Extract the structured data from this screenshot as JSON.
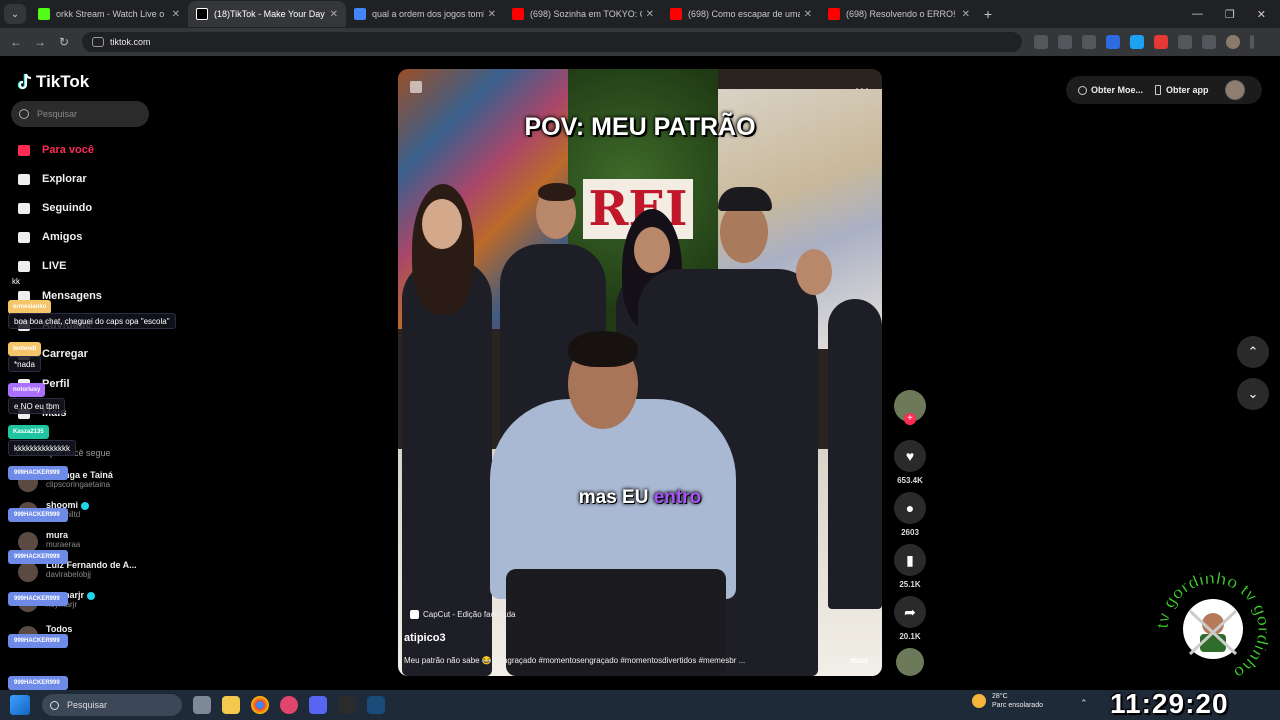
{
  "browser": {
    "tabs": [
      {
        "title": "orkk Stream - Watch Live o",
        "color": "#53fc18"
      },
      {
        "title": "(18)TikTok - Make Your Day",
        "color": "#000000",
        "active": true
      },
      {
        "title": "qual a ordem dos jogos tomb",
        "color": "#4285f4"
      },
      {
        "title": "(698) Sozinha em TOKYO: QUA",
        "color": "#ff0000"
      },
      {
        "title": "(698) Como escapar de uma pr",
        "color": "#ff0000"
      },
      {
        "title": "(698) Resolvendo o ERRO! Uni",
        "color": "#ff0000"
      }
    ],
    "url": "tiktok.com"
  },
  "sidebar": {
    "logo": "TikTok",
    "search_placeholder": "Pesquisar",
    "menu": [
      {
        "label": "Para você",
        "icon": "home-icon",
        "active": true
      },
      {
        "label": "Explorar",
        "icon": "compass-icon"
      },
      {
        "label": "Seguindo",
        "icon": "following-icon"
      },
      {
        "label": "Amigos",
        "icon": "friends-icon"
      },
      {
        "label": "LIVE",
        "icon": "live-icon"
      },
      {
        "label": "Mensagens",
        "icon": "messages-icon"
      },
      {
        "label": "Atividade",
        "icon": "activity-icon"
      },
      {
        "label": "Carregar",
        "icon": "upload-icon"
      },
      {
        "label": "Perfil",
        "icon": "profile-icon"
      },
      {
        "label": "Mais",
        "icon": "more-icon"
      }
    ],
    "following_header": "Contas que você segue",
    "accounts": [
      {
        "name": "Coringa e Tainá",
        "handle": "clipscoringaetaina",
        "verified": false
      },
      {
        "name": "shoomi",
        "handle": "shoomiltd",
        "verified": true
      },
      {
        "name": "mura",
        "handle": "muraeraa",
        "verified": false
      },
      {
        "name": "Luiz Fernando de A...",
        "handle": "davirabelobjj",
        "verified": false
      },
      {
        "name": "neymarjr",
        "handle": "neymarjr",
        "verified": true
      },
      {
        "name": "Todos",
        "handle": "",
        "verified": false
      }
    ]
  },
  "chat": [
    {
      "user": "ermeslanko",
      "badge_color": "#f5c56a",
      "text": "boa boa chat, cheguei do caps opa \"escola\""
    },
    {
      "user": "kk",
      "badge_color": "",
      "text": "kk"
    },
    {
      "user": "tentendi",
      "badge_color": "#f5c56a",
      "text": "*nada"
    },
    {
      "user": "notoriusy",
      "badge_color": "#a970ff",
      "text": "e NO eu tbm"
    },
    {
      "user": "Kasza2135",
      "badge_color": "#1fc5a1",
      "text": "kkkkkkkkkkkkkk"
    }
  ],
  "chat_spam_user": "999HACKER999",
  "video": {
    "caption_top": "POV: MEU PATRÃO",
    "caption_mid_prefix": "mas EU ",
    "caption_mid_highlight": "entro",
    "store_sign": "REI",
    "capcut": "CapCut - Edição facilitada",
    "author": "atipico3",
    "description": "Meu patrão não sabe 😂 #engraçado #momentosengraçado #momentosdivertidos #memesbr ...",
    "more": "mais",
    "likes": "653.4K",
    "comments": "2603",
    "saves": "25.1K",
    "shares": "20.1K"
  },
  "header": {
    "get_coins": "Obter Moe...",
    "get_app": "Obter app"
  },
  "watermark": {
    "text": "tv gordinho tv gordinho"
  },
  "taskbar": {
    "search": "Pesquisar",
    "weather_temp": "28°C",
    "weather_desc": "Parc ensolarado",
    "clock": "11:29:20"
  }
}
